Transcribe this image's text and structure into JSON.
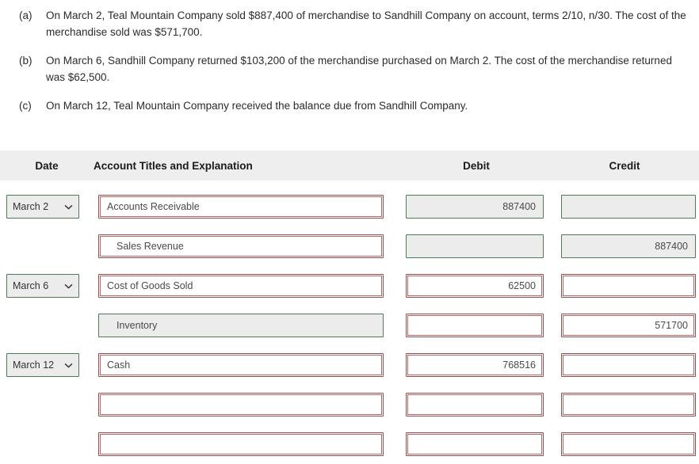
{
  "instructions": [
    {
      "label": "(a)",
      "text": "On March 2, Teal Mountain Company sold $887,400 of merchandise to Sandhill Company on account, terms 2/10, n/30. The cost of the merchandise sold was $571,700."
    },
    {
      "label": "(b)",
      "text": "On March 6, Sandhill Company returned $103,200 of the merchandise purchased on March 2. The cost of the merchandise returned was $62,500."
    },
    {
      "label": "(c)",
      "text": "On March 12, Teal Mountain Company received the balance due from Sandhill Company."
    }
  ],
  "table": {
    "headers": {
      "date": "Date",
      "account": "Account Titles and Explanation",
      "debit": "Debit",
      "credit": "Credit"
    },
    "rows": [
      {
        "date": "March 2",
        "has_date": true,
        "date_state": "locked",
        "account": "Accounts Receivable",
        "account_state": "editable",
        "account_indent": false,
        "debit": "887400",
        "debit_state": "locked",
        "credit": "",
        "credit_state": "locked"
      },
      {
        "date": "",
        "has_date": false,
        "date_state": "none",
        "account": "Sales Revenue",
        "account_state": "editable",
        "account_indent": true,
        "debit": "",
        "debit_state": "locked",
        "credit": "887400",
        "credit_state": "locked"
      },
      {
        "date": "March 6",
        "has_date": true,
        "date_state": "locked",
        "account": "Cost of Goods Sold",
        "account_state": "editable",
        "account_indent": false,
        "debit": "62500",
        "debit_state": "editable",
        "credit": "",
        "credit_state": "editable"
      },
      {
        "date": "",
        "has_date": false,
        "date_state": "none",
        "account": "Inventory",
        "account_state": "locked",
        "account_indent": true,
        "debit": "",
        "debit_state": "editable",
        "credit": "571700",
        "credit_state": "editable"
      },
      {
        "date": "March 12",
        "has_date": true,
        "date_state": "locked",
        "account": "Cash",
        "account_state": "editable",
        "account_indent": false,
        "debit": "768516",
        "debit_state": "editable",
        "credit": "",
        "credit_state": "editable"
      },
      {
        "date": "",
        "has_date": false,
        "date_state": "none",
        "account": "",
        "account_state": "editable",
        "account_indent": false,
        "debit": "",
        "debit_state": "editable",
        "credit": "",
        "credit_state": "editable"
      },
      {
        "date": "",
        "has_date": false,
        "date_state": "none",
        "account": "",
        "account_state": "editable",
        "account_indent": false,
        "debit": "",
        "debit_state": "editable",
        "credit": "",
        "credit_state": "editable"
      }
    ]
  },
  "icons": {
    "dropdown": "chevron-down-icon"
  },
  "colors": {
    "header_background": "#eeeeee",
    "editable_border": "#9e4a4a",
    "locked_border": "#4f7a5a",
    "locked_fill": "#ececec",
    "text": "#2b2b2b"
  }
}
